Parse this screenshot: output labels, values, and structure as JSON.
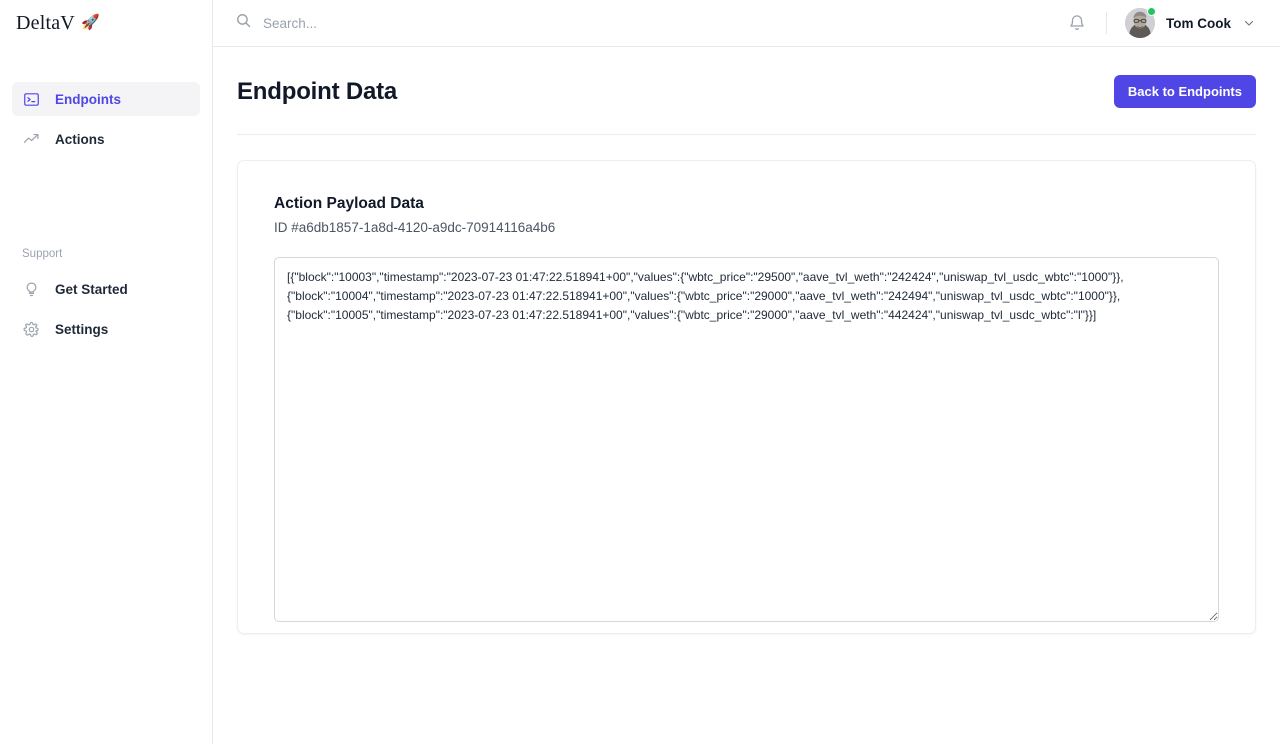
{
  "brand": {
    "name": "DeltaV",
    "rocket": "🚀"
  },
  "sidebar": {
    "items": [
      {
        "label": "Endpoints",
        "icon": "terminal-icon",
        "active": true
      },
      {
        "label": "Actions",
        "icon": "trending-up-icon",
        "active": false
      }
    ],
    "support_label": "Support",
    "support_items": [
      {
        "label": "Get Started",
        "icon": "lightbulb-icon"
      },
      {
        "label": "Settings",
        "icon": "gear-icon"
      }
    ]
  },
  "topbar": {
    "search": {
      "value": "",
      "placeholder": "Search..."
    },
    "notifications_icon": "bell-icon",
    "user": {
      "name": "Tom Cook",
      "status": "online",
      "chevron": "chevron-down-icon"
    }
  },
  "page": {
    "title": "Endpoint Data",
    "back_button": "Back to Endpoints"
  },
  "card": {
    "title": "Action Payload Data",
    "id_label": "ID #a6db1857-1a8d-4120-a9dc-70914116a4b6",
    "payload": "[{\"block\":\"10003\",\"timestamp\":\"2023-07-23 01:47:22.518941+00\",\"values\":{\"wbtc_price\":\"29500\",\"aave_tvl_weth\":\"242424\",\"uniswap_tvl_usdc_wbtc\":\"1000\"}},\n{\"block\":\"10004\",\"timestamp\":\"2023-07-23 01:47:22.518941+00\",\"values\":{\"wbtc_price\":\"29000\",\"aave_tvl_weth\":\"242494\",\"uniswap_tvl_usdc_wbtc\":\"1000\"}},\n{\"block\":\"10005\",\"timestamp\":\"2023-07-23 01:47:22.518941+00\",\"values\":{\"wbtc_price\":\"29000\",\"aave_tvl_weth\":\"442424\",\"uniswap_tvl_usdc_wbtc\":\"l\"}}]"
  },
  "colors": {
    "accent": "#4f46e5",
    "status_online": "#22c55e",
    "text_primary": "#111827",
    "border": "#e8e8ec"
  }
}
